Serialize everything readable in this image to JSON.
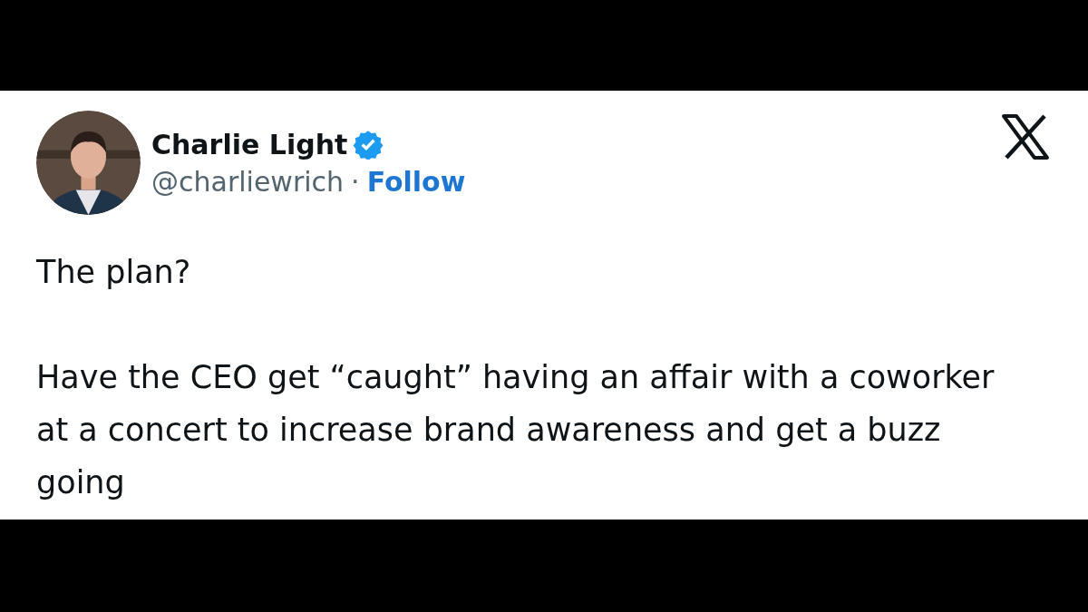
{
  "tweet": {
    "author": {
      "name": "Charlie Light",
      "verified": true,
      "handle": "@charliewrich",
      "separator": "·",
      "follow": "Follow"
    },
    "paragraphs": [
      "The plan?",
      "Have the CEO get “caught” having an affair with a coworker at a concert to increase brand awareness and get a buzz going"
    ]
  }
}
